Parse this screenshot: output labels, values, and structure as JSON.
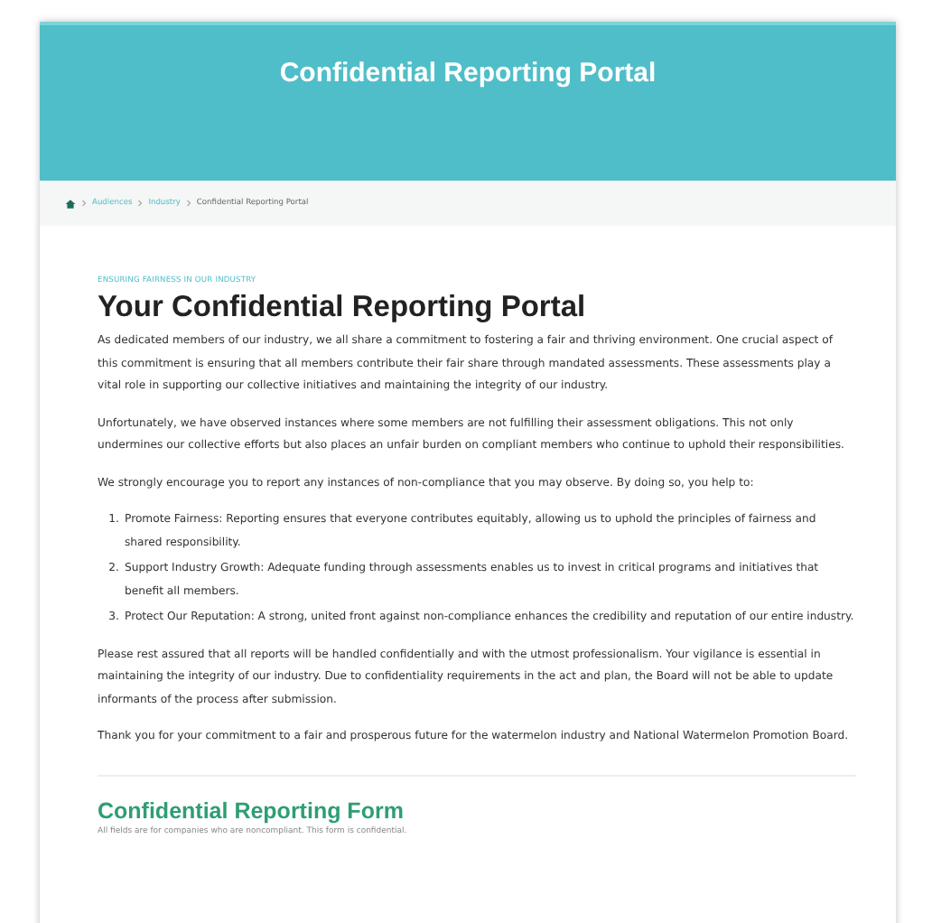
{
  "header": {
    "title": "Confidential Reporting Portal"
  },
  "breadcrumb": [
    "Audiences",
    "Industry",
    "Confidential Reporting Portal"
  ],
  "eyebrow": "ENSURING FAIRNESS IN OUR INDUSTRY",
  "heading": "Your Confidential Reporting Portal",
  "intro": [
    "As dedicated members of our industry, we all share a commitment to fostering a fair and thriving environment. One crucial aspect of this commitment is ensuring that all members contribute their fair share through mandated assessments. These assessments play a vital role in supporting our collective initiatives and maintaining the integrity of our industry.",
    "Unfortunately, we have observed instances where some members are not fulfilling their assessment obligations. This not only undermines our collective efforts but also places an unfair burden on compliant members who continue to uphold their responsibilities.",
    "We strongly encourage you to report any instances of non-compliance that you may observe. By doing so, you help to:"
  ],
  "list": [
    {
      "marker": "1.",
      "text": "Promote Fairness: Reporting ensures that everyone contributes equitably, allowing us to uphold the principles of fairness and shared responsibility."
    },
    {
      "marker": "2.",
      "text": "Support Industry Growth: Adequate funding through assessments enables us to invest in critical programs and initiatives that benefit all members."
    },
    {
      "marker": "3.",
      "text": "Protect Our Reputation: A strong, united front against non-compliance enhances the credibility and reputation of our entire industry."
    }
  ],
  "outro": [
    "Please rest assured that all reports will be handled confidentially and with the utmost professionalism. Your vigilance is essential in maintaining the integrity of our industry. Due to confidentiality requirements in the act and plan, the Board will not be able to update informants of the process after submission.",
    "Thank you for your commitment to a fair and prosperous future for the watermelon industry and National Watermelon Promotion Board."
  ],
  "form": {
    "title": "Confidential Reporting Form",
    "note": "All fields are for companies who are noncompliant. This form is confidential."
  }
}
